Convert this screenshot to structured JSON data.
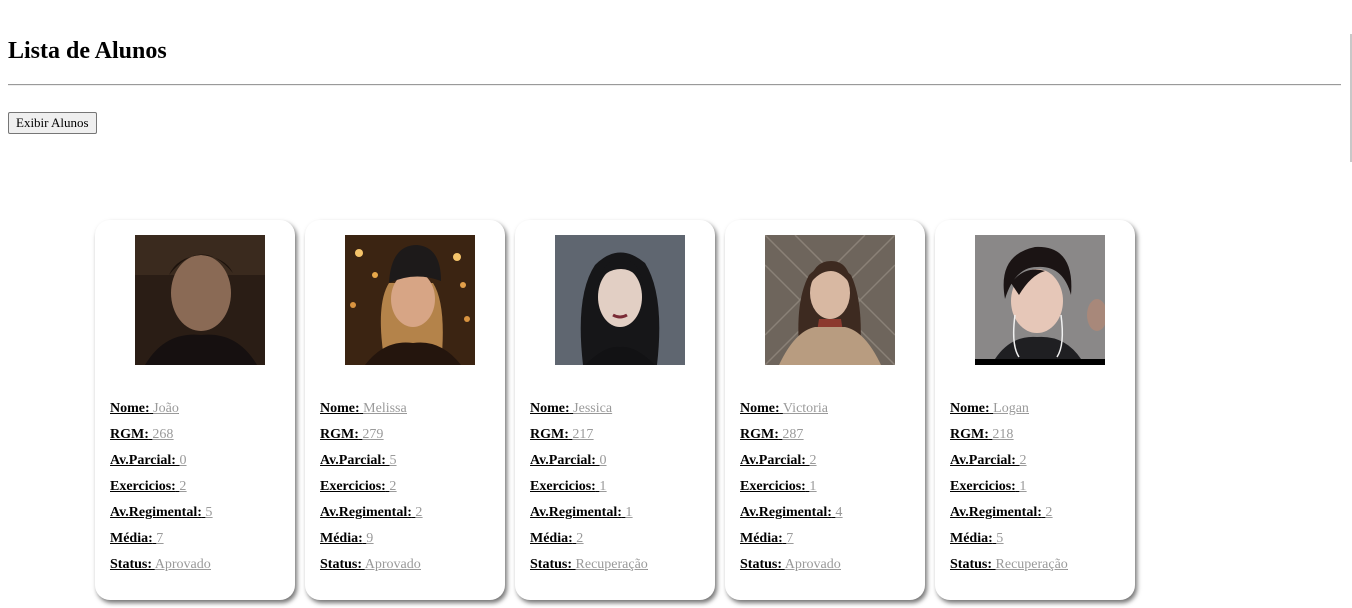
{
  "page": {
    "title": "Lista de Alunos",
    "button_label": "Exibir Alunos"
  },
  "labels": {
    "nome": "Nome:",
    "rgm": "RGM:",
    "parcial": "Av.Parcial:",
    "exercicios": "Exercicios:",
    "regimental": "Av.Regimental:",
    "media": "Média:",
    "status": "Status:"
  },
  "students": [
    {
      "nome": "João",
      "rgm": "268",
      "parcial": "0",
      "exercicios": "2",
      "regimental": "5",
      "media": "7",
      "status": "Aprovado"
    },
    {
      "nome": "Melissa",
      "rgm": "279",
      "parcial": "5",
      "exercicios": "2",
      "regimental": "2",
      "media": "9",
      "status": "Aprovado"
    },
    {
      "nome": "Jessica",
      "rgm": "217",
      "parcial": "0",
      "exercicios": "1",
      "regimental": "1",
      "media": "2",
      "status": "Recuperação"
    },
    {
      "nome": "Victoria",
      "rgm": "287",
      "parcial": "2",
      "exercicios": "1",
      "regimental": "4",
      "media": "7",
      "status": "Aprovado"
    },
    {
      "nome": "Logan",
      "rgm": "218",
      "parcial": "2",
      "exercicios": "1",
      "regimental": "2",
      "media": "5",
      "status": "Recuperação"
    }
  ],
  "colors": {
    "value_text": "#9a9a9a",
    "card_background": "#ffffff"
  }
}
